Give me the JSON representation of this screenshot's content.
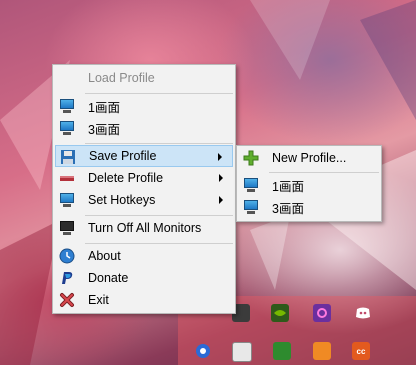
{
  "menu": {
    "items": [
      {
        "label": "Load Profile",
        "icon": "none",
        "disabled": true
      },
      {
        "label": "1画面",
        "icon": "monitor-icon"
      },
      {
        "label": "3画面",
        "icon": "monitor-icon"
      },
      {
        "label": "Save Profile",
        "icon": "floppy-disk-icon",
        "submenu": true,
        "highlighted": true
      },
      {
        "label": "Delete Profile",
        "icon": "delete-bar-icon",
        "submenu": true
      },
      {
        "label": "Set Hotkeys",
        "icon": "monitor-icon",
        "submenu": true
      },
      {
        "label": "Turn Off All Monitors",
        "icon": "dark-monitor-icon"
      },
      {
        "label": "About",
        "icon": "clock-icon"
      },
      {
        "label": "Donate",
        "icon": "paypal-icon"
      },
      {
        "label": "Exit",
        "icon": "red-x-icon"
      }
    ]
  },
  "submenu": {
    "items": [
      {
        "label": "New Profile...",
        "icon": "plus-icon"
      },
      {
        "label": "1画面",
        "icon": "monitor-icon"
      },
      {
        "label": "3画面",
        "icon": "monitor-icon"
      }
    ]
  },
  "tray": {
    "icons": [
      "monitor-tray-icon",
      "nvidia-icon",
      "app-purple-icon",
      "discord-icon",
      "blue-circle-icon",
      "monitor-status-icon",
      "green-app-icon",
      "orange-app-icon",
      "cc-app-icon"
    ]
  },
  "colors": {
    "highlight": "#cce4f7",
    "highlight_border": "#99c9ef",
    "menu_bg": "#f2f2f2"
  }
}
